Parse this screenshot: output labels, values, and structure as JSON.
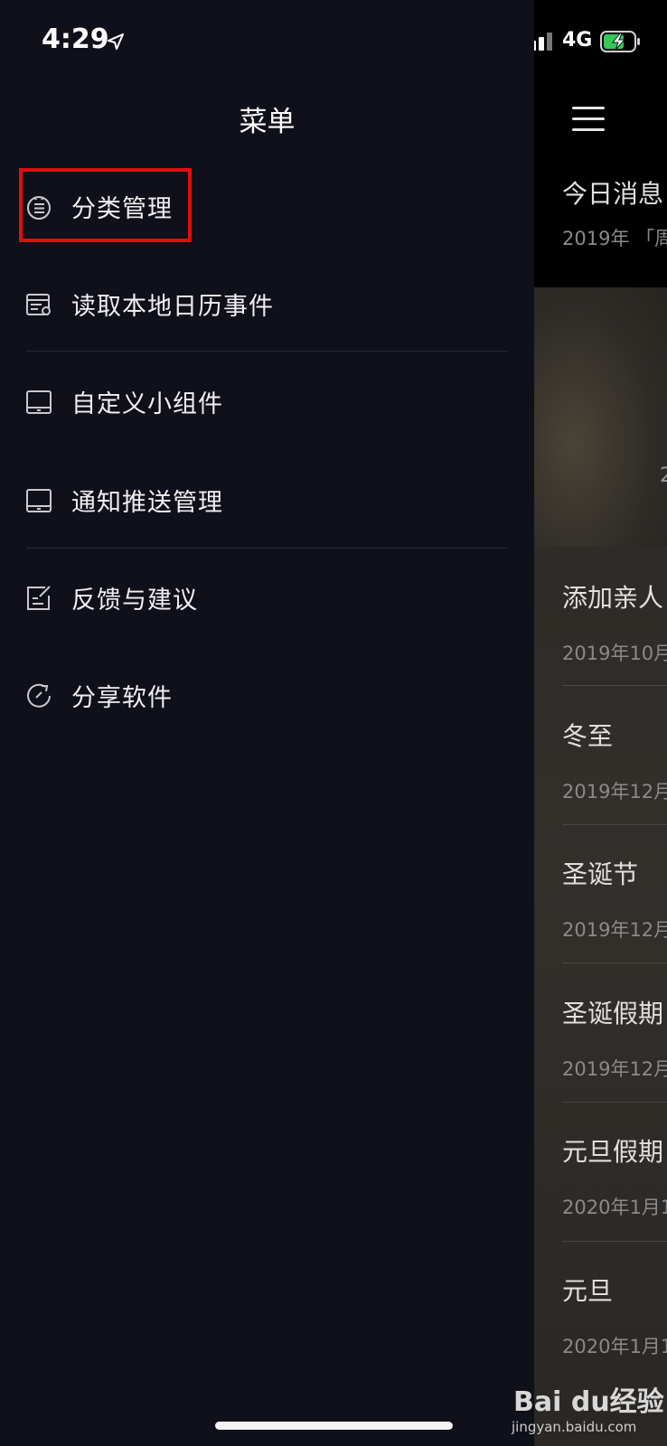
{
  "status_bar": {
    "time": "4:29",
    "network": "4G"
  },
  "drawer": {
    "title": "菜单",
    "items": [
      {
        "label": "分类管理",
        "icon": "category-list-icon"
      },
      {
        "label": "读取本地日历事件",
        "icon": "calendar-import-icon"
      },
      {
        "label": "自定义小组件",
        "icon": "widget-tablet-icon"
      },
      {
        "label": "通知推送管理",
        "icon": "notification-tablet-icon"
      },
      {
        "label": "反馈与建议",
        "icon": "feedback-edit-icon"
      },
      {
        "label": "分享软件",
        "icon": "share-refresh-icon"
      }
    ]
  },
  "background_screen": {
    "header": {
      "title": "今日消息",
      "subtitle": "2019年 「周"
    },
    "hero_fragment": "2",
    "events": [
      {
        "name": "添加亲人",
        "date": "2019年10月"
      },
      {
        "name": "冬至",
        "date": "2019年12月"
      },
      {
        "name": "圣诞节",
        "date": "2019年12月"
      },
      {
        "name": "圣诞假期",
        "date": "2019年12月"
      },
      {
        "name": "元旦假期",
        "date": "2020年1月1"
      },
      {
        "name": "元旦",
        "date": "2020年1月1"
      }
    ]
  },
  "watermark": {
    "brand": "Bai du经验",
    "url": "jingyan.baidu.com"
  },
  "colors": {
    "highlight": "#e10e0e",
    "drawer_bg": "#0f1019",
    "battery_fill": "#35c759"
  }
}
